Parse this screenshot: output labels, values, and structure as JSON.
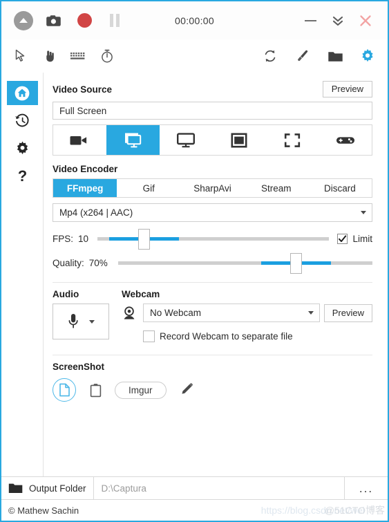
{
  "titlebar": {
    "timer": "00:00:00",
    "collapse_label": "collapse",
    "screenshot_label": "ScreenShot",
    "record_label": "Record",
    "pause_label": "Pause",
    "minimize_label": "Minimize",
    "tray_label": "Minimize to Tray",
    "close_label": "Close"
  },
  "toolbar": {
    "left": [
      {
        "name": "cursor-icon",
        "label": "Include Cursor"
      },
      {
        "name": "clicks-icon",
        "label": "Include Clicks"
      },
      {
        "name": "keystrokes-icon",
        "label": "Include Keystrokes"
      },
      {
        "name": "timer-icon",
        "label": "Recording Timer"
      }
    ],
    "right": [
      {
        "name": "refresh-icon",
        "label": "Refresh"
      },
      {
        "name": "brush-icon",
        "label": "Image Editor"
      },
      {
        "name": "folder-icon",
        "label": "Open Output Folder"
      },
      {
        "name": "gear-icon",
        "label": "Settings"
      }
    ]
  },
  "sidebar": {
    "items": [
      {
        "name": "sidebar-item-home",
        "label": "Home",
        "active": true
      },
      {
        "name": "sidebar-item-history",
        "label": "Recent",
        "active": false
      },
      {
        "name": "sidebar-item-settings",
        "label": "Configure",
        "active": false
      },
      {
        "name": "sidebar-item-about",
        "label": "About",
        "active": false
      }
    ]
  },
  "video_source": {
    "title": "Video Source",
    "preview_label": "Preview",
    "selected": "Full Screen",
    "modes": [
      {
        "name": "source-mode-video-device",
        "label": "Video Device",
        "active": false
      },
      {
        "name": "source-mode-desktop-duplication",
        "label": "Desktop Duplication",
        "active": true
      },
      {
        "name": "source-mode-screen",
        "label": "Screen",
        "active": false
      },
      {
        "name": "source-mode-window",
        "label": "Window",
        "active": false
      },
      {
        "name": "source-mode-region",
        "label": "Region",
        "active": false
      },
      {
        "name": "source-mode-game",
        "label": "Game",
        "active": false
      }
    ]
  },
  "video_encoder": {
    "title": "Video Encoder",
    "tabs": [
      {
        "name": "encoder-tab-ffmpeg",
        "label": "FFmpeg",
        "active": true
      },
      {
        "name": "encoder-tab-gif",
        "label": "Gif",
        "active": false
      },
      {
        "name": "encoder-tab-sharpavi",
        "label": "SharpAvi",
        "active": false
      },
      {
        "name": "encoder-tab-stream",
        "label": "Stream",
        "active": false
      },
      {
        "name": "encoder-tab-discard",
        "label": "Discard",
        "active": false
      }
    ],
    "format": "Mp4 (x264 | AAC)",
    "fps_label": "FPS:",
    "fps_value": "10",
    "fps_percent": 20,
    "limit_label": "Limit",
    "limit_checked": true,
    "quality_label": "Quality:",
    "quality_value": "70%",
    "quality_percent": 70
  },
  "audio": {
    "title": "Audio",
    "device_icon": "microphone-icon"
  },
  "webcam": {
    "title": "Webcam",
    "selected": "No Webcam",
    "preview_label": "Preview",
    "separate_file_label": "Record Webcam to separate file",
    "separate_file_checked": false
  },
  "screenshot": {
    "title": "ScreenShot",
    "save_to_disk_label": "Save to Disk",
    "copy_to_clipboard_label": "Copy to Clipboard",
    "imgur_label": "Imgur",
    "edit_label": "Open in Editor"
  },
  "output": {
    "folder_label": "Output Folder",
    "path": "D:\\Captura",
    "more_label": "..."
  },
  "status": {
    "copyright": "© Mathew Sachin",
    "watermark": "https://blog.csdn.net/wei",
    "watermark2": "@51CTO博客"
  },
  "colors": {
    "accent": "#29a8e0",
    "record": "#d14545",
    "close": "#f09a9a"
  }
}
